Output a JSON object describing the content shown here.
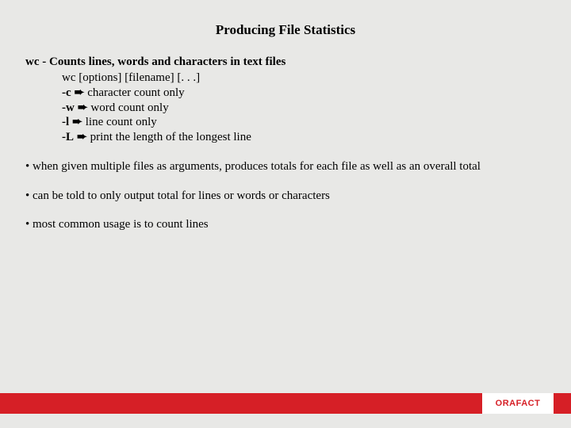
{
  "title": "Producing File Statistics",
  "command": {
    "name": "wc",
    "dash": " - ",
    "desc": "Counts lines, words and characters in text files",
    "usage": "wc [options] [filename] [. . .]",
    "options": [
      {
        "flag": "-c",
        "arrow": "➨",
        "desc": "character count only"
      },
      {
        "flag": "-w",
        "arrow": "➨",
        "desc": "word count only"
      },
      {
        "flag": "-l",
        "arrow": "➨",
        "desc": "line count only"
      },
      {
        "flag": "-L",
        "arrow": "➨",
        "desc": "print the length of the longest line"
      }
    ]
  },
  "bullets": [
    "• when given multiple files as arguments, produces totals for each file as well as an overall total",
    "• can be told to only output total for lines or words or characters",
    "• most common usage is to count lines"
  ],
  "footer": {
    "brand": "ORAFACT"
  },
  "colors": {
    "accent": "#d61f26",
    "bg": "#e8e8e6"
  }
}
